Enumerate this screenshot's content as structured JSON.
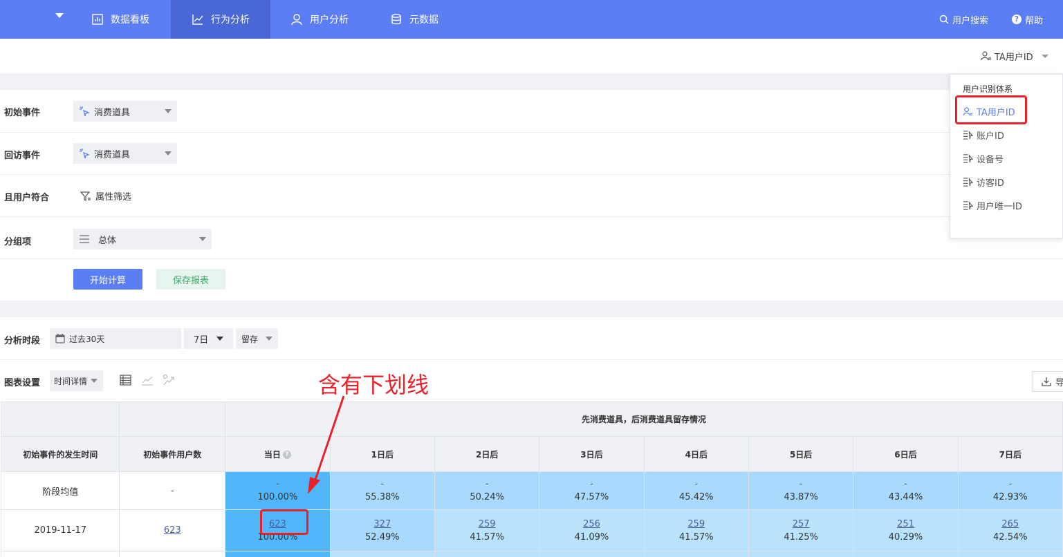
{
  "nav": {
    "items": [
      {
        "label": "数据看板",
        "icon": "bar-chart-icon"
      },
      {
        "label": "行为分析",
        "icon": "line-chart-icon"
      },
      {
        "label": "用户分析",
        "icon": "user-icon"
      },
      {
        "label": "元数据",
        "icon": "database-icon"
      }
    ],
    "search_label": "用户搜索",
    "help_label": "帮助"
  },
  "id_select": {
    "value": "TA用户ID"
  },
  "dropdown": {
    "title": "用户识别体系",
    "items": [
      "TA用户ID",
      "账户ID",
      "设备号",
      "访客ID",
      "用户唯一ID"
    ]
  },
  "form": {
    "initial_event_label": "初始事件",
    "initial_event_value": "消费道具",
    "return_event_label": "回访事件",
    "return_event_value": "消费道具",
    "user_filter_label": "且用户符合",
    "user_filter_link": "属性筛选",
    "group_label": "分组项",
    "group_value": "总体",
    "calc_button": "开始计算",
    "save_button": "保存报表"
  },
  "analysis": {
    "period_label": "分析时段",
    "period_value": "过去30天",
    "days_value": "7日",
    "mode_value": "留存",
    "chart_settings_label": "图表设置",
    "chart_view_value": "时间详情",
    "export_label": "导"
  },
  "annotation": "含有下划线",
  "table": {
    "header_group": "先消费道具，后消费道具留存情况",
    "col_time": "初始事件的发生时间",
    "col_users": "初始事件用户数",
    "day_cols": [
      "当日",
      "1日后",
      "2日后",
      "3日后",
      "4日后",
      "5日后",
      "6日后",
      "7日后"
    ],
    "rows": [
      {
        "label": "阶段均值",
        "users": "-",
        "cells": [
          {
            "top": "-",
            "bot": "100.00%"
          },
          {
            "top": "-",
            "bot": "55.38%"
          },
          {
            "top": "-",
            "bot": "50.24%"
          },
          {
            "top": "-",
            "bot": "47.57%"
          },
          {
            "top": "-",
            "bot": "45.42%"
          },
          {
            "top": "-",
            "bot": "43.87%"
          },
          {
            "top": "-",
            "bot": "43.44%"
          },
          {
            "top": "-",
            "bot": "42.93%"
          }
        ]
      },
      {
        "label": "2019-11-17",
        "users": "623",
        "cells": [
          {
            "top": "623",
            "bot": "100.00%"
          },
          {
            "top": "327",
            "bot": "52.49%"
          },
          {
            "top": "259",
            "bot": "41.57%"
          },
          {
            "top": "256",
            "bot": "41.09%"
          },
          {
            "top": "259",
            "bot": "41.57%"
          },
          {
            "top": "257",
            "bot": "41.25%"
          },
          {
            "top": "251",
            "bot": "40.29%"
          },
          {
            "top": "265",
            "bot": "42.54%"
          }
        ]
      }
    ]
  },
  "colors": {
    "nav": "#5b7ef5",
    "accent": "#5b7ef5",
    "annotation": "#e8212b"
  }
}
